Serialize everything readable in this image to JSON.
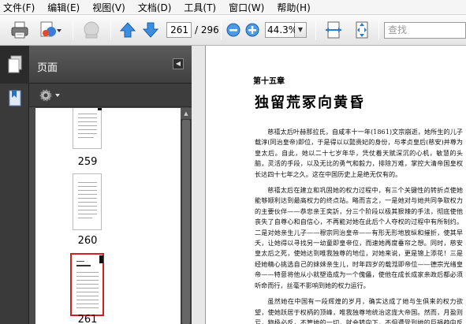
{
  "menu": [
    "文件(F)",
    "编辑(E)",
    "视图(V)",
    "文档(D)",
    "工具(T)",
    "窗口(W)",
    "帮助(H)"
  ],
  "toolbar": {
    "icons": [
      "print-icon",
      "share-icon",
      "stamp-icon",
      "prev-page-icon",
      "next-page-icon",
      "zoom-out-icon",
      "zoom-in-icon",
      "fit-width-icon",
      "fit-page-icon"
    ],
    "page_current": "261",
    "page_total": "/ 296",
    "zoom": "44.3%",
    "search_placeholder": "查找"
  },
  "panel": {
    "title": "页面",
    "thumbnails": [
      {
        "label": "259",
        "selected": false
      },
      {
        "label": "260",
        "selected": false
      },
      {
        "label": "261",
        "selected": true
      }
    ]
  },
  "document": {
    "chapter": "第十五章",
    "title": "独留荒冢向黄昏",
    "paragraphs": [
      "慈禧太后叶赫那拉氏，自咸丰十一年(1861)文宗崩逝，她所生的儿子载淳(同治皇帝)即位，于是得以以懿贵妃的身份，与孝贞皇后(慈安)并尊为皇太后。自此，她以二十七岁年华，凭仗着天赋深沉的心机，敏慧的头脑，灵活的手段，以及无比的勇气和毅力，排除万难，掌控大清帝国皇权长达四十七年之久。这在中国历史上是绝无仅有的。",
      "慈禧太后在建立和巩固她的权力过程中，有三个关键性的转折点使她能够顺利达到最高权力的终点站。略而言之，一是她对与她共同争取权力的主要伙伴——恭忠亲王奕訢，分三个阶段以极其狠辣的手法，彻底使他丧失了自尊心和自信心，不再能对她在此后个人夺权的过程中有所制约。二是对她亲生儿子——穆宗同治皇帝——有形无形地放纵和摧折，使其早夭，让她得以寻找另一幼童即皇帝位，而速她再度垂帘之想。同时，慈安皇太后之死，使她达到唯我独尊的地位，对她来说，更是锦上添花！三是经她精心挑选自己的妹妹亲生儿，时年四岁的载湉即帝位——德宗光绪皇帝——特意将他从小就塑造成为一个傀儡，使他在成长成家亲政后都必须听命而行，丝毫不影响到她的权力运行。",
      "虽然她在中国有一段辉煌的岁月，确实达成了她与生俱来的权力欲望，使她跃居于权柄的顶峰，唯我独尊地统治这庞大帝国。然而，月盈则亏，物极必反，不管她的一切，就会转向下，不但遭受到她的巨祸趋向反对她，外国列强更虎视眈眈着这古老的帝国视为待宰之羊，群起而噬！"
    ]
  }
}
